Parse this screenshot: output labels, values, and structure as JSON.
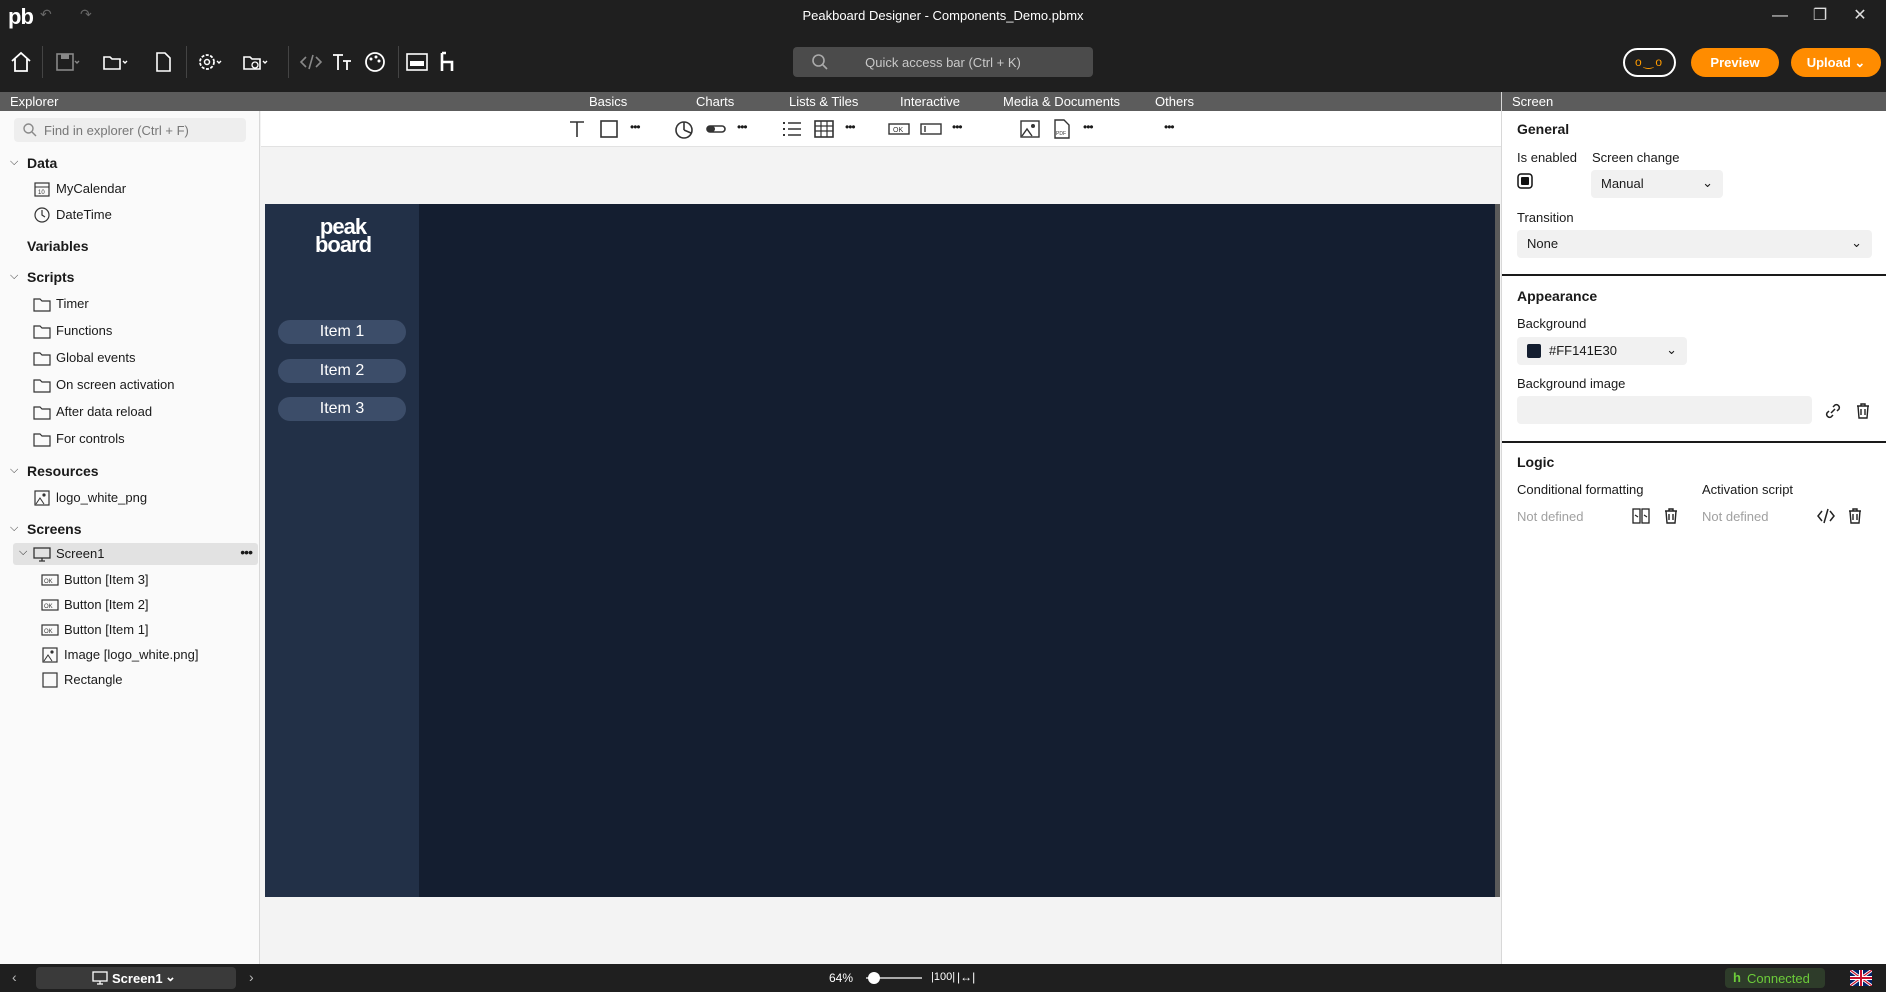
{
  "app": {
    "logo": "pb",
    "window_title": "Peakboard Designer - Components_Demo.pbmx"
  },
  "toolbar": {
    "quick_access_placeholder": "Quick access bar (Ctrl + K)",
    "preview_label": "Preview",
    "upload_label": "Upload"
  },
  "menu_strip": {
    "explorer_label": "Explorer",
    "categories": [
      "Basics",
      "Charts",
      "Lists & Tiles",
      "Interactive",
      "Media & Documents",
      "Others"
    ]
  },
  "explorer": {
    "search_placeholder": "Find in explorer (Ctrl + F)",
    "sections": {
      "data": "Data",
      "variables": "Variables",
      "scripts": "Scripts",
      "resources": "Resources",
      "screens": "Screens"
    },
    "data_items": [
      "MyCalendar",
      "DateTime"
    ],
    "script_items": [
      "Timer",
      "Functions",
      "Global events",
      "On screen activation",
      "After data reload",
      "For controls"
    ],
    "resource_items": [
      "logo_white_png"
    ],
    "screen_name": "Screen1",
    "screen_children": [
      "Button [Item 3]",
      "Button [Item 2]",
      "Button [Item 1]",
      "Image [logo_white.png]",
      "Rectangle"
    ]
  },
  "canvas": {
    "logo_text_line1": "peak",
    "logo_text_line2": "board",
    "buttons": [
      "Item 1",
      "Item 2",
      "Item 3"
    ],
    "background_color": "#141e30",
    "sidebar_color": "#223047"
  },
  "properties": {
    "header": "Screen",
    "general": {
      "title": "General",
      "is_enabled_label": "Is enabled",
      "screen_change_label": "Screen change",
      "screen_change_value": "Manual",
      "transition_label": "Transition",
      "transition_value": "None"
    },
    "appearance": {
      "title": "Appearance",
      "background_label": "Background",
      "background_value": "#FF141E30",
      "background_image_label": "Background image"
    },
    "logic": {
      "title": "Logic",
      "conditional_formatting_label": "Conditional formatting",
      "conditional_formatting_value": "Not defined",
      "activation_script_label": "Activation script",
      "activation_script_value": "Not defined"
    }
  },
  "statusbar": {
    "screen_selector": "Screen1",
    "zoom": "64%",
    "connection_status": "Connected"
  },
  "colors": {
    "accent": "#ff8c00",
    "dark_bg": "#1f1f1f",
    "connected": "#6ccc3a"
  }
}
